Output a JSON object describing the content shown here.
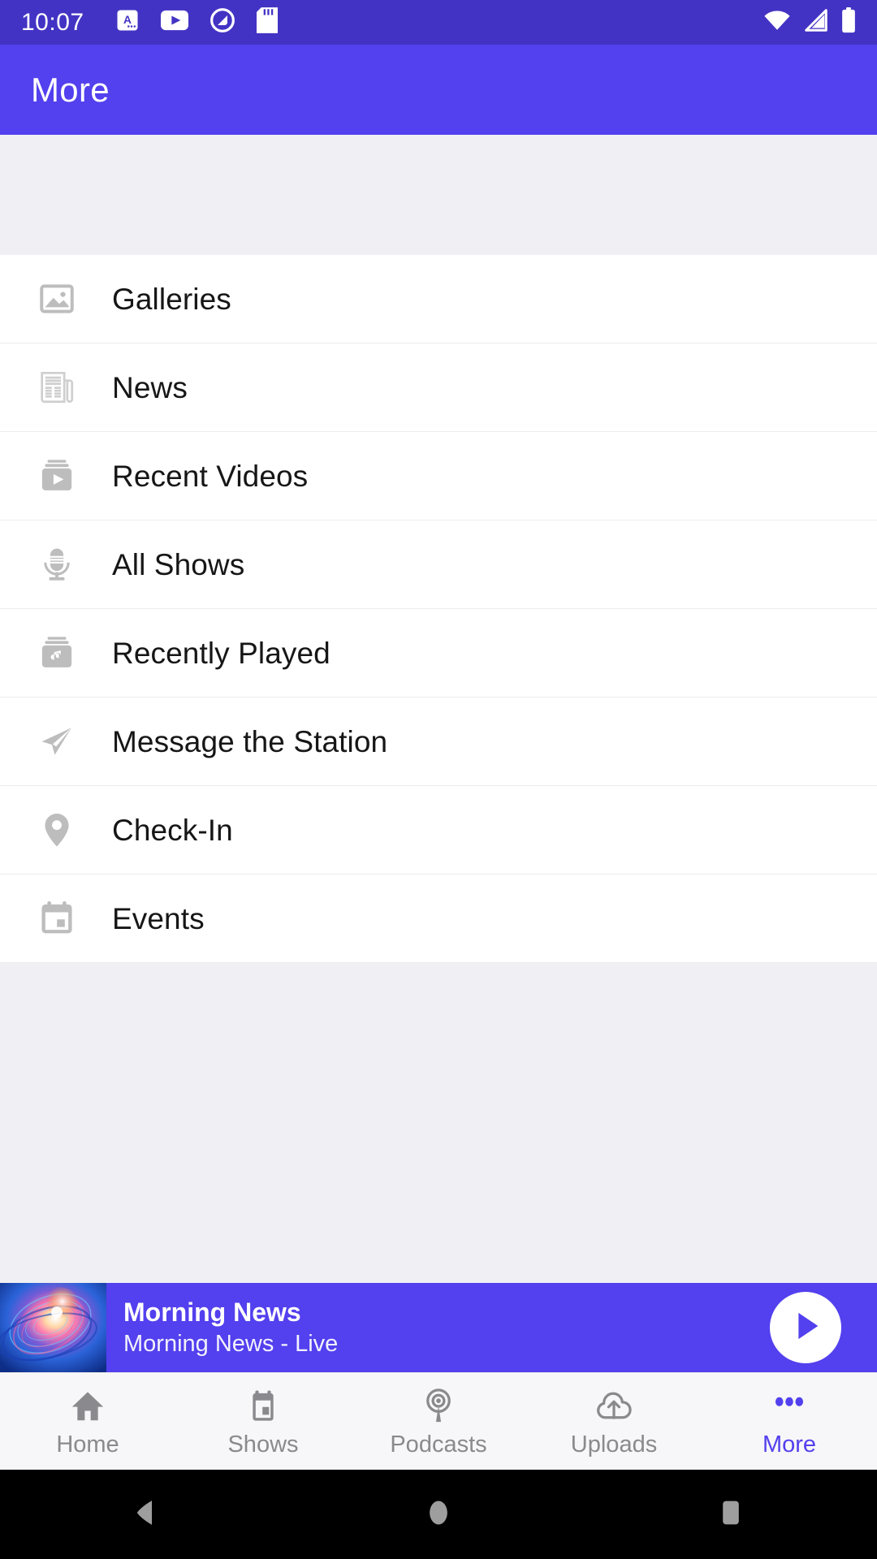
{
  "status_bar": {
    "time": "10:07",
    "left_icons": [
      "app-badge-icon",
      "youtube-icon",
      "quizlet-icon",
      "sd-card-icon"
    ],
    "right_icons": [
      "wifi-icon",
      "cellular-signal-icon",
      "battery-icon"
    ],
    "background_color": "#4333c4"
  },
  "app_bar": {
    "title": "More",
    "background_color": "#5340ee"
  },
  "menu": {
    "items": [
      {
        "label": "Galleries",
        "icon": "image-icon"
      },
      {
        "label": "News",
        "icon": "newspaper-icon"
      },
      {
        "label": "Recent Videos",
        "icon": "video-library-icon"
      },
      {
        "label": "All Shows",
        "icon": "microphone-icon"
      },
      {
        "label": "Recently Played",
        "icon": "music-library-icon"
      },
      {
        "label": "Message the Station",
        "icon": "send-icon"
      },
      {
        "label": "Check-In",
        "icon": "location-pin-icon"
      },
      {
        "label": "Events",
        "icon": "calendar-icon"
      }
    ]
  },
  "now_playing": {
    "title": "Morning News",
    "subtitle": "Morning News - Live",
    "play_button_icon": "play-icon",
    "artwork": "blue-pink-swirl-vortex",
    "background_color": "#5340ee"
  },
  "bottom_nav": {
    "accent_color": "#5340ee",
    "inactive_color": "#8a8a8e",
    "items": [
      {
        "label": "Home",
        "icon": "home-icon",
        "active": false
      },
      {
        "label": "Shows",
        "icon": "calendar-icon",
        "active": false
      },
      {
        "label": "Podcasts",
        "icon": "podcast-icon",
        "active": false
      },
      {
        "label": "Uploads",
        "icon": "cloud-upload-icon",
        "active": false
      },
      {
        "label": "More",
        "icon": "more-dots-icon",
        "active": true
      }
    ]
  },
  "android_nav": {
    "buttons": [
      "back-icon",
      "home-icon",
      "recents-icon"
    ]
  }
}
